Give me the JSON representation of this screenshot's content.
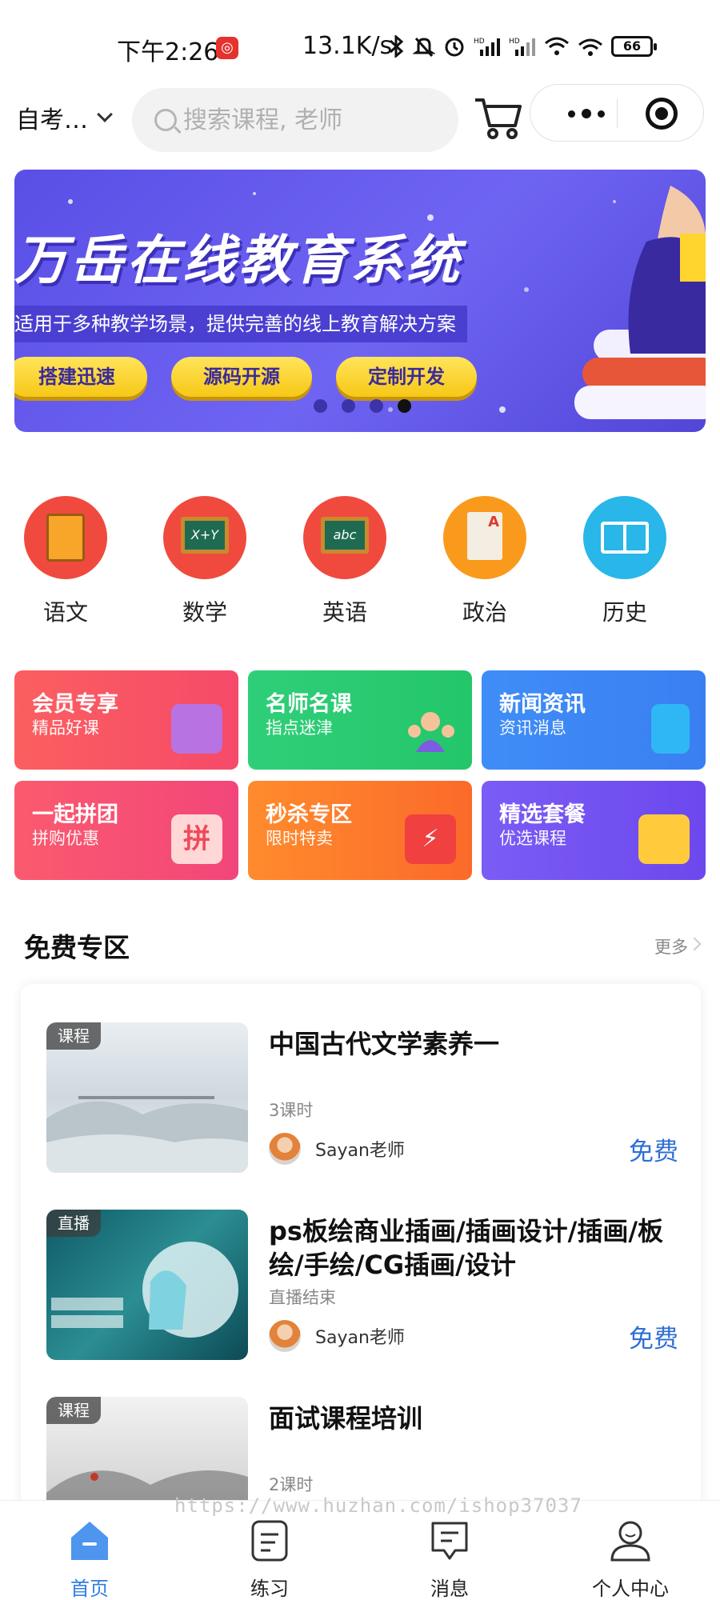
{
  "status_bar": {
    "time": "下午2:26",
    "app_badge": "◎",
    "network_speed": "13.1K/s",
    "icons": [
      "bluetooth-icon",
      "mute-icon",
      "alarm-icon",
      "signal-icon",
      "signal-icon",
      "wifi-icon",
      "hotspot-icon"
    ],
    "battery": "66"
  },
  "header": {
    "region": "自考…",
    "search_placeholder": "搜索课程, 老师"
  },
  "banner": {
    "title": "万岳在线教育系统",
    "subtitle": "适用于多种教学场景，提供完善的线上教育解决方案",
    "tags": [
      "搭建迅速",
      "源码开源",
      "定制开发"
    ],
    "slides": 4,
    "active_slide": 4
  },
  "categories": [
    {
      "label": "语文",
      "color": "#f04a3f",
      "icon": "book-icon"
    },
    {
      "label": "数学",
      "color": "#f04a3f",
      "icon": "chalkboard-icon",
      "text": "X+Y"
    },
    {
      "label": "英语",
      "color": "#f04a3f",
      "icon": "chalkboard-icon",
      "text": "abc"
    },
    {
      "label": "政治",
      "color": "#fa9a1c",
      "icon": "document-icon"
    },
    {
      "label": "历史",
      "color": "#29b6e8",
      "icon": "open-book-icon"
    }
  ],
  "feature_cards": [
    {
      "title": "会员专享",
      "subtitle": "精品好课",
      "gradient": [
        "#fb5f5f",
        "#f64a6a"
      ],
      "icon": "vip-folder-icon"
    },
    {
      "title": "名师名课",
      "subtitle": "指点迷津",
      "gradient": [
        "#2fcf79",
        "#24c66a"
      ],
      "icon": "teachers-icon"
    },
    {
      "title": "新闻资讯",
      "subtitle": "资讯消息",
      "gradient": [
        "#3f8df7",
        "#3a7ff2"
      ],
      "icon": "news-icon"
    },
    {
      "title": "一起拼团",
      "subtitle": "拼购优惠",
      "gradient": [
        "#fb5a6e",
        "#f2467a"
      ],
      "icon": "group-buy-icon"
    },
    {
      "title": "秒杀专区",
      "subtitle": "限时特卖",
      "gradient": [
        "#ff8b2d",
        "#fb6a2a"
      ],
      "icon": "flash-sale-icon"
    },
    {
      "title": "精选套餐",
      "subtitle": "优选课程",
      "gradient": [
        "#7b5cf5",
        "#6c48ee"
      ],
      "icon": "package-icon"
    }
  ],
  "free_section": {
    "title": "免费专区",
    "more": "更多",
    "courses": [
      {
        "badge": "课程",
        "title": "中国古代文学素养一",
        "meta": "3课时",
        "teacher": "Sayan老师",
        "price": "免费",
        "thumb": "ink"
      },
      {
        "badge": "直播",
        "title": "ps板绘商业插画/插画设计/插画/板绘/手绘/CG插画/设计",
        "meta": "直播结束",
        "teacher": "Sayan老师",
        "price": "免费",
        "thumb": "teal"
      },
      {
        "badge": "课程",
        "title": "面试课程培训",
        "meta": "2课时",
        "teacher": "",
        "price": "",
        "thumb": "ink2"
      }
    ]
  },
  "watermark": "https://www.huzhan.com/ishop37037",
  "tabbar": [
    {
      "label": "首页",
      "active": true,
      "icon": "home-icon"
    },
    {
      "label": "练习",
      "active": false,
      "icon": "practice-icon"
    },
    {
      "label": "消息",
      "active": false,
      "icon": "message-icon"
    },
    {
      "label": "个人中心",
      "active": false,
      "icon": "profile-icon"
    }
  ],
  "colors": {
    "accent": "#2f7fe0",
    "price": "#2f6fd6"
  }
}
